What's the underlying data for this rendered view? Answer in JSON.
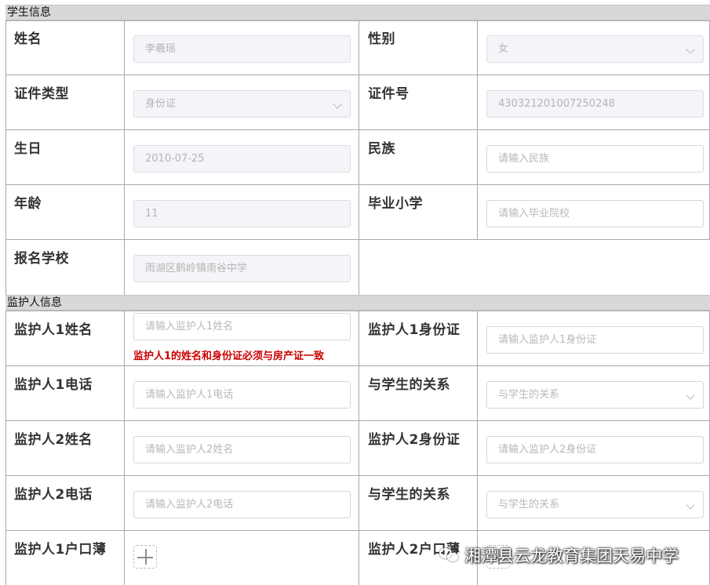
{
  "student_section": {
    "title": "学生信息"
  },
  "student": {
    "name": {
      "label": "姓名",
      "value": "李羲瑶"
    },
    "gender": {
      "label": "性别",
      "value": "女"
    },
    "id_type": {
      "label": "证件类型",
      "value": "身份证"
    },
    "id_number": {
      "label": "证件号",
      "value": "430321201007250248"
    },
    "birthday": {
      "label": "生日",
      "value": "2010-07-25"
    },
    "ethnicity": {
      "label": "民族",
      "placeholder": "请输入民族"
    },
    "age": {
      "label": "年龄",
      "value": "11"
    },
    "primary_school": {
      "label": "毕业小学",
      "placeholder": "请输入毕业院校"
    },
    "school": {
      "label": "报名学校",
      "value": "雨湖区鹤岭镇南谷中学"
    }
  },
  "guardian_section": {
    "title": "监护人信息"
  },
  "guardian": {
    "g1_name": {
      "label": "监护人1姓名",
      "placeholder": "请输入监护人1姓名",
      "note": "监护人1的姓名和身份证必须与房产证一致"
    },
    "g1_id": {
      "label": "监护人1身份证",
      "placeholder": "请输入监护人1身份证"
    },
    "g1_phone": {
      "label": "监护人1电话",
      "placeholder": "请输入监护人1电话"
    },
    "g1_relation": {
      "label": "与学生的关系",
      "placeholder": "与学生的关系"
    },
    "g2_name": {
      "label": "监护人2姓名",
      "placeholder": "请输入监护人2姓名"
    },
    "g2_id": {
      "label": "监护人2身份证",
      "placeholder": "请输入监护人2身份证"
    },
    "g2_phone": {
      "label": "监护人2电话",
      "placeholder": "请输入监护人2电话"
    },
    "g2_relation": {
      "label": "与学生的关系",
      "placeholder": "与学生的关系"
    },
    "g1_hukou": {
      "label": "监护人1户口薄"
    },
    "g2_hukou": {
      "label": "监护人2户口薄"
    }
  },
  "watermark": {
    "text": "湘潭县云龙教育集团天易中学",
    "icon": "wechat-icon"
  },
  "colors": {
    "note": "#cc0000",
    "header_bg": "#d8d8d8",
    "border": "#a9a9a9"
  }
}
